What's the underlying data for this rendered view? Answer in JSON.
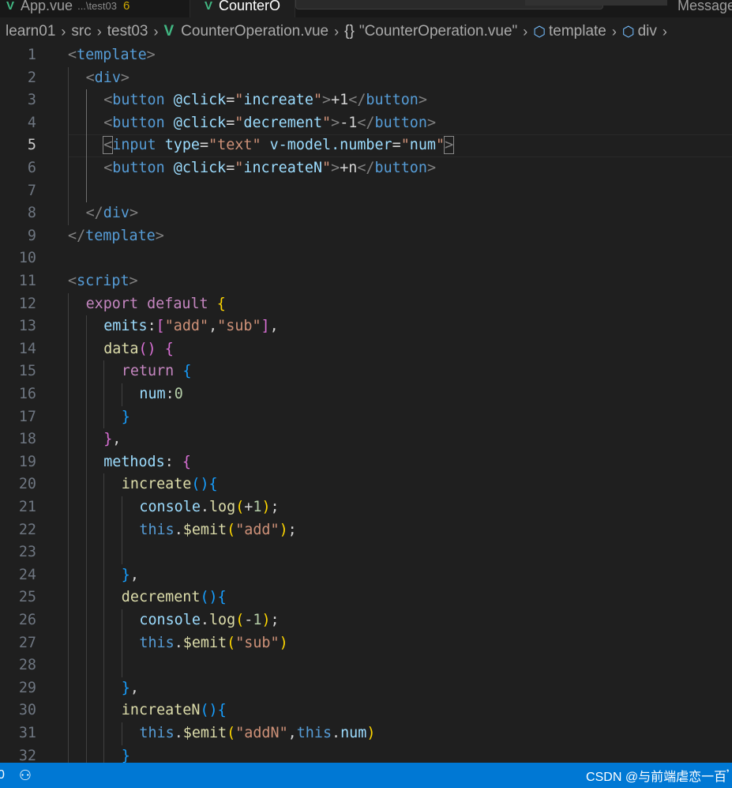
{
  "tabs": [
    {
      "label": "App.vue",
      "dir": "...\\test03",
      "count": "6"
    },
    {
      "label": "CounterO"
    },
    {
      "label": "Message"
    }
  ],
  "breadcrumb": [
    "learn01",
    "src",
    "test03",
    "CounterOperation.vue",
    "\"CounterOperation.vue\"",
    "template",
    "div"
  ],
  "editor": {
    "current_line": 5,
    "lines": [
      {
        "n": "1",
        "tokens": [
          {
            "c": "t-br",
            "t": "<"
          },
          {
            "c": "t-tag",
            "t": "template"
          },
          {
            "c": "t-br",
            "t": ">"
          }
        ],
        "indent": 0
      },
      {
        "n": "2",
        "tokens": [
          {
            "c": "t-br",
            "t": "<"
          },
          {
            "c": "t-tag",
            "t": "div"
          },
          {
            "c": "t-br",
            "t": ">"
          }
        ],
        "indent": 1
      },
      {
        "n": "3",
        "tokens": [
          {
            "c": "t-br",
            "t": "<"
          },
          {
            "c": "t-tag",
            "t": "button"
          },
          {
            "c": "t-txt",
            "t": " "
          },
          {
            "c": "t-attr",
            "t": "@click"
          },
          {
            "c": "t-txt",
            "t": "="
          },
          {
            "c": "t-str",
            "t": "\""
          },
          {
            "c": "t-attr",
            "t": "increate"
          },
          {
            "c": "t-str",
            "t": "\""
          },
          {
            "c": "t-br",
            "t": ">"
          },
          {
            "c": "t-txt",
            "t": "+1"
          },
          {
            "c": "t-br",
            "t": "</"
          },
          {
            "c": "t-tag",
            "t": "button"
          },
          {
            "c": "t-br",
            "t": ">"
          }
        ],
        "indent": 2
      },
      {
        "n": "4",
        "tokens": [
          {
            "c": "t-br",
            "t": "<"
          },
          {
            "c": "t-tag",
            "t": "button"
          },
          {
            "c": "t-txt",
            "t": " "
          },
          {
            "c": "t-attr",
            "t": "@click"
          },
          {
            "c": "t-txt",
            "t": "="
          },
          {
            "c": "t-str",
            "t": "\""
          },
          {
            "c": "t-attr",
            "t": "decrement"
          },
          {
            "c": "t-str",
            "t": "\""
          },
          {
            "c": "t-br",
            "t": ">"
          },
          {
            "c": "t-txt",
            "t": "-1"
          },
          {
            "c": "t-br",
            "t": "</"
          },
          {
            "c": "t-tag",
            "t": "button"
          },
          {
            "c": "t-br",
            "t": ">"
          }
        ],
        "indent": 2
      },
      {
        "n": "5",
        "tokens": [
          {
            "c": "t-br t-bhl",
            "t": "<"
          },
          {
            "c": "t-tag",
            "t": "input"
          },
          {
            "c": "t-txt",
            "t": " "
          },
          {
            "c": "t-attr",
            "t": "type"
          },
          {
            "c": "t-txt",
            "t": "="
          },
          {
            "c": "t-str",
            "t": "\"text\""
          },
          {
            "c": "t-txt",
            "t": " "
          },
          {
            "c": "t-attr",
            "t": "v-model.number"
          },
          {
            "c": "t-txt",
            "t": "="
          },
          {
            "c": "t-str",
            "t": "\""
          },
          {
            "c": "t-attr",
            "t": "num"
          },
          {
            "c": "t-str",
            "t": "\""
          },
          {
            "c": "t-br t-bhl",
            "t": ">"
          }
        ],
        "indent": 2
      },
      {
        "n": "6",
        "tokens": [
          {
            "c": "t-br",
            "t": "<"
          },
          {
            "c": "t-tag",
            "t": "button"
          },
          {
            "c": "t-txt",
            "t": " "
          },
          {
            "c": "t-attr",
            "t": "@click"
          },
          {
            "c": "t-txt",
            "t": "="
          },
          {
            "c": "t-str",
            "t": "\""
          },
          {
            "c": "t-attr",
            "t": "increateN"
          },
          {
            "c": "t-str",
            "t": "\""
          },
          {
            "c": "t-br",
            "t": ">"
          },
          {
            "c": "t-txt",
            "t": "+n"
          },
          {
            "c": "t-br",
            "t": "</"
          },
          {
            "c": "t-tag",
            "t": "button"
          },
          {
            "c": "t-br",
            "t": ">"
          }
        ],
        "indent": 2
      },
      {
        "n": "7",
        "tokens": [],
        "indent": 2
      },
      {
        "n": "8",
        "tokens": [
          {
            "c": "t-br",
            "t": "</"
          },
          {
            "c": "t-tag",
            "t": "div"
          },
          {
            "c": "t-br",
            "t": ">"
          }
        ],
        "indent": 1
      },
      {
        "n": "9",
        "tokens": [
          {
            "c": "t-br",
            "t": "</"
          },
          {
            "c": "t-tag",
            "t": "template"
          },
          {
            "c": "t-br",
            "t": ">"
          }
        ],
        "indent": 0
      },
      {
        "n": "10",
        "tokens": [],
        "indent": 0
      },
      {
        "n": "11",
        "tokens": [
          {
            "c": "t-br",
            "t": "<"
          },
          {
            "c": "t-tag",
            "t": "script"
          },
          {
            "c": "t-br",
            "t": ">"
          }
        ],
        "indent": 0
      },
      {
        "n": "12",
        "tokens": [
          {
            "c": "t-kw",
            "t": "export"
          },
          {
            "c": "t-txt",
            "t": " "
          },
          {
            "c": "t-kw",
            "t": "default"
          },
          {
            "c": "t-txt",
            "t": " "
          },
          {
            "c": "t-p1",
            "t": "{"
          }
        ],
        "indent": 1
      },
      {
        "n": "13",
        "tokens": [
          {
            "c": "t-var",
            "t": "emits"
          },
          {
            "c": "t-pun",
            "t": ":"
          },
          {
            "c": "t-p2",
            "t": "["
          },
          {
            "c": "t-str",
            "t": "\"add\""
          },
          {
            "c": "t-pun",
            "t": ","
          },
          {
            "c": "t-str",
            "t": "\"sub\""
          },
          {
            "c": "t-p2",
            "t": "]"
          },
          {
            "c": "t-pun",
            "t": ","
          }
        ],
        "indent": 2
      },
      {
        "n": "14",
        "tokens": [
          {
            "c": "t-fn",
            "t": "data"
          },
          {
            "c": "t-p2",
            "t": "()"
          },
          {
            "c": "t-txt",
            "t": " "
          },
          {
            "c": "t-p2",
            "t": "{"
          }
        ],
        "indent": 2
      },
      {
        "n": "15",
        "tokens": [
          {
            "c": "t-kw",
            "t": "return"
          },
          {
            "c": "t-txt",
            "t": " "
          },
          {
            "c": "t-p3",
            "t": "{"
          }
        ],
        "indent": 3
      },
      {
        "n": "16",
        "tokens": [
          {
            "c": "t-var",
            "t": "num"
          },
          {
            "c": "t-pun",
            "t": ":"
          },
          {
            "c": "t-num",
            "t": "0"
          }
        ],
        "indent": 4
      },
      {
        "n": "17",
        "tokens": [
          {
            "c": "t-p3",
            "t": "}"
          }
        ],
        "indent": 3
      },
      {
        "n": "18",
        "tokens": [
          {
            "c": "t-p2",
            "t": "}"
          },
          {
            "c": "t-pun",
            "t": ","
          }
        ],
        "indent": 2
      },
      {
        "n": "19",
        "tokens": [
          {
            "c": "t-var",
            "t": "methods"
          },
          {
            "c": "t-pun",
            "t": ":"
          },
          {
            "c": "t-txt",
            "t": " "
          },
          {
            "c": "t-p2",
            "t": "{"
          }
        ],
        "indent": 2
      },
      {
        "n": "20",
        "tokens": [
          {
            "c": "t-fn",
            "t": "increate"
          },
          {
            "c": "t-p3",
            "t": "(){"
          }
        ],
        "indent": 3
      },
      {
        "n": "21",
        "tokens": [
          {
            "c": "t-var",
            "t": "console"
          },
          {
            "c": "t-pun",
            "t": "."
          },
          {
            "c": "t-fn",
            "t": "log"
          },
          {
            "c": "t-p1",
            "t": "("
          },
          {
            "c": "t-pun",
            "t": "+"
          },
          {
            "c": "t-num",
            "t": "1"
          },
          {
            "c": "t-p1",
            "t": ")"
          },
          {
            "c": "t-pun",
            "t": ";"
          }
        ],
        "indent": 4
      },
      {
        "n": "22",
        "tokens": [
          {
            "c": "t-kw2",
            "t": "this"
          },
          {
            "c": "t-pun",
            "t": "."
          },
          {
            "c": "t-fn",
            "t": "$emit"
          },
          {
            "c": "t-p1",
            "t": "("
          },
          {
            "c": "t-str",
            "t": "\"add\""
          },
          {
            "c": "t-p1",
            "t": ")"
          },
          {
            "c": "t-pun",
            "t": ";"
          }
        ],
        "indent": 4
      },
      {
        "n": "23",
        "tokens": [],
        "indent": 4
      },
      {
        "n": "24",
        "tokens": [
          {
            "c": "t-p3",
            "t": "}"
          },
          {
            "c": "t-pun",
            "t": ","
          }
        ],
        "indent": 3
      },
      {
        "n": "25",
        "tokens": [
          {
            "c": "t-fn",
            "t": "decrement"
          },
          {
            "c": "t-p3",
            "t": "(){"
          }
        ],
        "indent": 3
      },
      {
        "n": "26",
        "tokens": [
          {
            "c": "t-var",
            "t": "console"
          },
          {
            "c": "t-pun",
            "t": "."
          },
          {
            "c": "t-fn",
            "t": "log"
          },
          {
            "c": "t-p1",
            "t": "("
          },
          {
            "c": "t-pun",
            "t": "-"
          },
          {
            "c": "t-num",
            "t": "1"
          },
          {
            "c": "t-p1",
            "t": ")"
          },
          {
            "c": "t-pun",
            "t": ";"
          }
        ],
        "indent": 4
      },
      {
        "n": "27",
        "tokens": [
          {
            "c": "t-kw2",
            "t": "this"
          },
          {
            "c": "t-pun",
            "t": "."
          },
          {
            "c": "t-fn",
            "t": "$emit"
          },
          {
            "c": "t-p1",
            "t": "("
          },
          {
            "c": "t-str",
            "t": "\"sub\""
          },
          {
            "c": "t-p1",
            "t": ")"
          }
        ],
        "indent": 4
      },
      {
        "n": "28",
        "tokens": [],
        "indent": 4
      },
      {
        "n": "29",
        "tokens": [
          {
            "c": "t-p3",
            "t": "}"
          },
          {
            "c": "t-pun",
            "t": ","
          }
        ],
        "indent": 3
      },
      {
        "n": "30",
        "tokens": [
          {
            "c": "t-fn",
            "t": "increateN"
          },
          {
            "c": "t-p3",
            "t": "(){"
          }
        ],
        "indent": 3
      },
      {
        "n": "31",
        "tokens": [
          {
            "c": "t-kw2",
            "t": "this"
          },
          {
            "c": "t-pun",
            "t": "."
          },
          {
            "c": "t-fn",
            "t": "$emit"
          },
          {
            "c": "t-p1",
            "t": "("
          },
          {
            "c": "t-str",
            "t": "\"addN\""
          },
          {
            "c": "t-pun",
            "t": ","
          },
          {
            "c": "t-kw2",
            "t": "this"
          },
          {
            "c": "t-pun",
            "t": "."
          },
          {
            "c": "t-var",
            "t": "num"
          },
          {
            "c": "t-p1",
            "t": ")"
          }
        ],
        "indent": 4
      },
      {
        "n": "32",
        "tokens": [
          {
            "c": "t-p3",
            "t": "}"
          }
        ],
        "indent": 3
      }
    ]
  },
  "statusbar": {
    "errors": "0",
    "debug_icon": "debug-icon",
    "watermark": "CSDN @与前端虐恋一百𝄒"
  },
  "colors": {
    "accent": "#0078d4",
    "vue": "#41b883",
    "editor_bg": "#1f1f1f"
  }
}
